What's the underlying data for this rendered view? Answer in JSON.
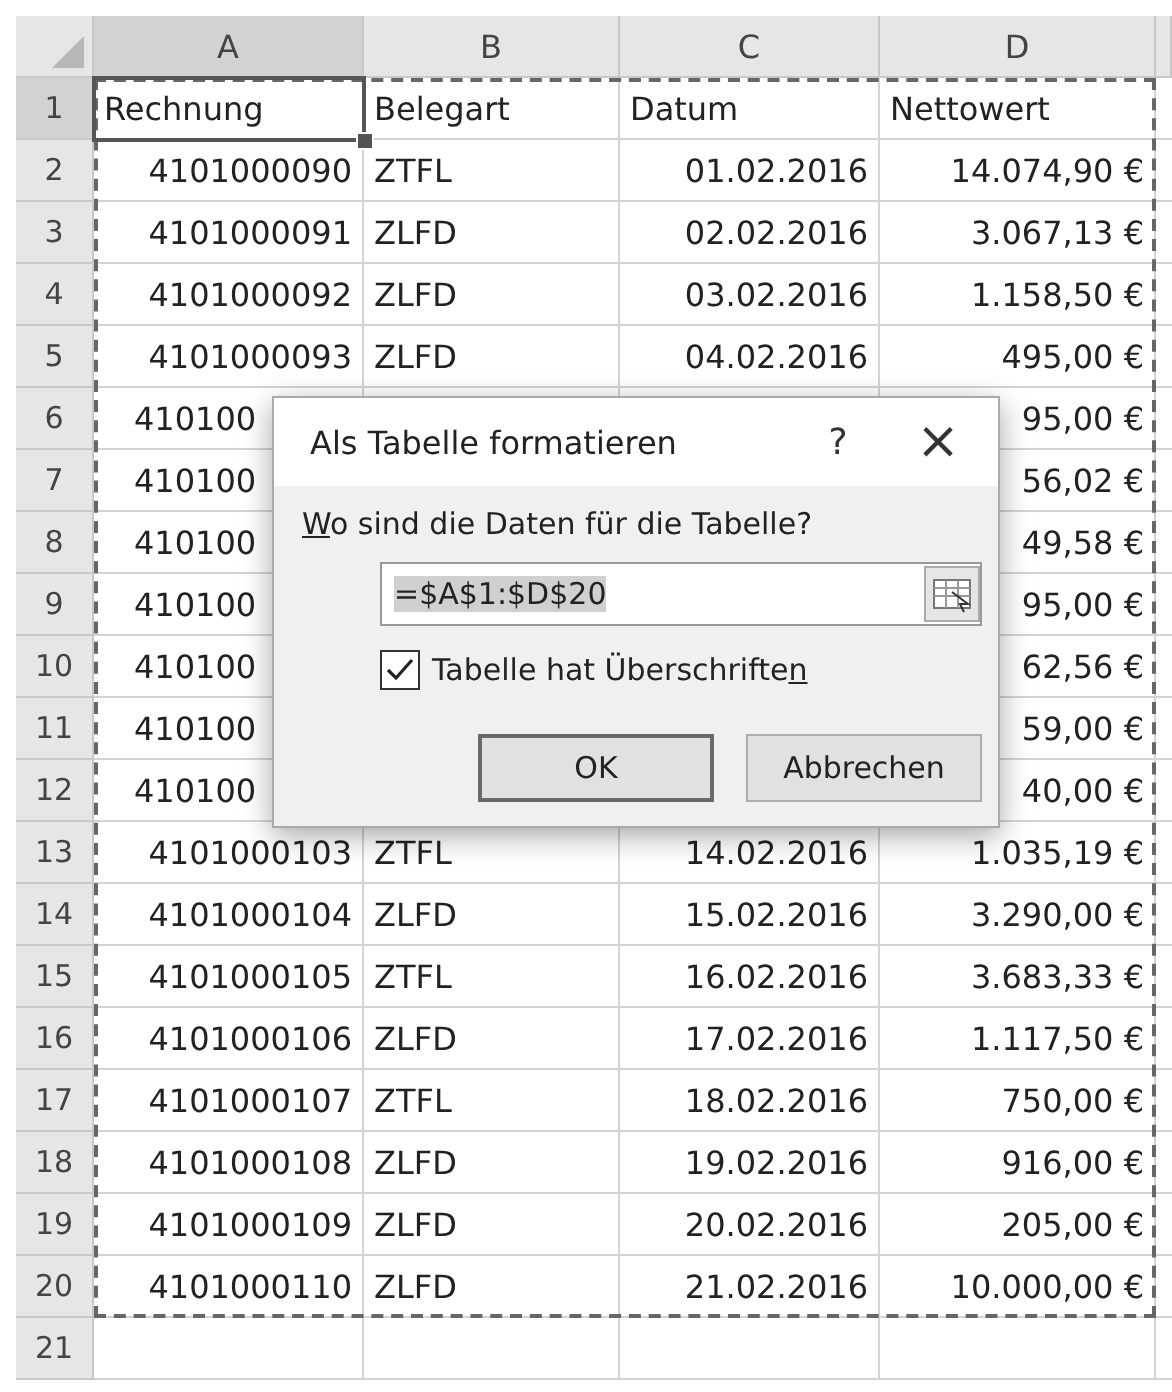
{
  "columns": [
    {
      "label": "A",
      "selected": true
    },
    {
      "label": "B",
      "selected": false
    },
    {
      "label": "C",
      "selected": false
    },
    {
      "label": "D",
      "selected": false
    }
  ],
  "rows": [
    {
      "number": "1",
      "selected": true,
      "covered": false,
      "cells": [
        "Rechnung",
        "Belegart",
        "Datum",
        "Nettowert"
      ]
    },
    {
      "number": "2",
      "selected": false,
      "covered": false,
      "cells": [
        "4101000090",
        "ZTFL",
        "01.02.2016",
        "14.074,90 €"
      ]
    },
    {
      "number": "3",
      "selected": false,
      "covered": false,
      "cells": [
        "4101000091",
        "ZLFD",
        "02.02.2016",
        "3.067,13 €"
      ]
    },
    {
      "number": "4",
      "selected": false,
      "covered": false,
      "cells": [
        "4101000092",
        "ZLFD",
        "03.02.2016",
        "1.158,50 €"
      ]
    },
    {
      "number": "5",
      "selected": false,
      "covered": false,
      "cells": [
        "4101000093",
        "ZLFD",
        "04.02.2016",
        "495,00 €"
      ]
    },
    {
      "number": "6",
      "selected": false,
      "covered": true,
      "cells": [
        "410100",
        "",
        "",
        "95,00 €"
      ]
    },
    {
      "number": "7",
      "selected": false,
      "covered": true,
      "cells": [
        "410100",
        "",
        "",
        "56,02 €"
      ]
    },
    {
      "number": "8",
      "selected": false,
      "covered": true,
      "cells": [
        "410100",
        "",
        "",
        "49,58 €"
      ]
    },
    {
      "number": "9",
      "selected": false,
      "covered": true,
      "cells": [
        "410100",
        "",
        "",
        "95,00 €"
      ]
    },
    {
      "number": "10",
      "selected": false,
      "covered": true,
      "cells": [
        "410100",
        "",
        "",
        "62,56 €"
      ]
    },
    {
      "number": "11",
      "selected": false,
      "covered": true,
      "cells": [
        "410100",
        "",
        "",
        "59,00 €"
      ]
    },
    {
      "number": "12",
      "selected": false,
      "covered": true,
      "cells": [
        "410100",
        "",
        "",
        "40,00 €"
      ]
    },
    {
      "number": "13",
      "selected": false,
      "covered": false,
      "cells": [
        "4101000103",
        "ZTFL",
        "14.02.2016",
        "1.035,19 €"
      ]
    },
    {
      "number": "14",
      "selected": false,
      "covered": false,
      "cells": [
        "4101000104",
        "ZLFD",
        "15.02.2016",
        "3.290,00 €"
      ]
    },
    {
      "number": "15",
      "selected": false,
      "covered": false,
      "cells": [
        "4101000105",
        "ZTFL",
        "16.02.2016",
        "3.683,33 €"
      ]
    },
    {
      "number": "16",
      "selected": false,
      "covered": false,
      "cells": [
        "4101000106",
        "ZLFD",
        "17.02.2016",
        "1.117,50 €"
      ]
    },
    {
      "number": "17",
      "selected": false,
      "covered": false,
      "cells": [
        "4101000107",
        "ZTFL",
        "18.02.2016",
        "750,00 €"
      ]
    },
    {
      "number": "18",
      "selected": false,
      "covered": false,
      "cells": [
        "4101000108",
        "ZLFD",
        "19.02.2016",
        "916,00 €"
      ]
    },
    {
      "number": "19",
      "selected": false,
      "covered": false,
      "cells": [
        "4101000109",
        "ZLFD",
        "20.02.2016",
        "205,00 €"
      ]
    },
    {
      "number": "20",
      "selected": false,
      "covered": false,
      "cells": [
        "4101000110",
        "ZLFD",
        "21.02.2016",
        "10.000,00 €"
      ]
    },
    {
      "number": "21",
      "selected": false
    }
  ],
  "dialog": {
    "title": "Als Tabelle formatieren",
    "help": "?",
    "close": "×",
    "prompt": {
      "key": "W",
      "rest": "o sind die Daten für die Tabelle?"
    },
    "range": "=$A$1:$D$20",
    "checkbox": {
      "text": "Tabelle hat Überschrifte",
      "key": "n",
      "checked": true
    },
    "buttons": [
      {
        "label": "OK",
        "default": true
      },
      {
        "label": "Abbrechen",
        "default": false
      }
    ]
  }
}
